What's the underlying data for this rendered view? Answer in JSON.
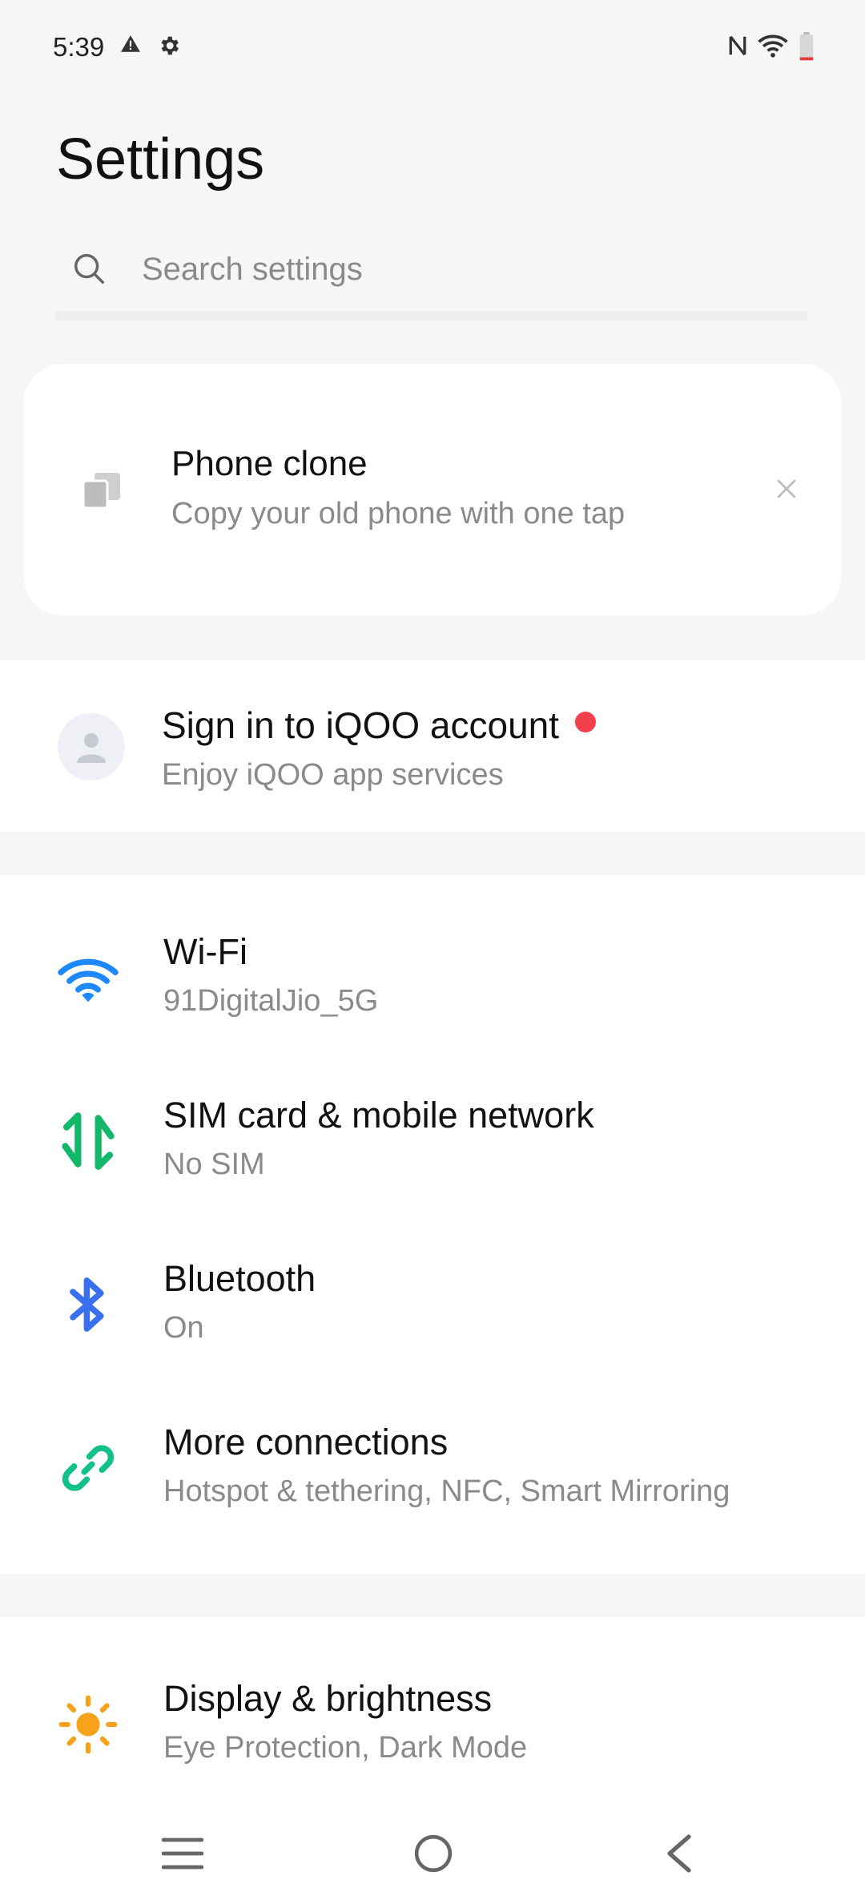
{
  "status_bar": {
    "time": "5:39",
    "icons": [
      "alert-icon",
      "settings-gear-icon",
      "nfc-icon",
      "wifi-icon",
      "battery-low-icon"
    ],
    "battery_color": "#e53935"
  },
  "page_title": "Settings",
  "search": {
    "placeholder": "Search settings"
  },
  "phone_clone_card": {
    "title": "Phone clone",
    "subtitle": "Copy your old phone with one tap"
  },
  "account": {
    "title": "Sign in to iQOO account",
    "subtitle": "Enjoy iQOO app services",
    "badge_color": "#f2404f"
  },
  "connections": [
    {
      "title": "Wi-Fi",
      "subtitle": "91DigitalJio_5G",
      "icon": "wifi-icon",
      "color": "#1e88ff"
    },
    {
      "title": "SIM card & mobile network",
      "subtitle": "No SIM",
      "icon": "mobile-data-icon",
      "color": "#12b76a"
    },
    {
      "title": "Bluetooth",
      "subtitle": "On",
      "icon": "bluetooth-icon",
      "color": "#3a6ff0"
    },
    {
      "title": "More connections",
      "subtitle": "Hotspot & tethering, NFC, Smart Mirroring",
      "icon": "link-icon",
      "color": "#12c08a"
    }
  ],
  "display": {
    "title": "Display & brightness",
    "subtitle": "Eye Protection, Dark Mode",
    "icon": "sun-icon",
    "color": "#f7a21a"
  },
  "nav_bar": {
    "icons": [
      "menu-icon",
      "home-icon",
      "back-icon"
    ]
  }
}
